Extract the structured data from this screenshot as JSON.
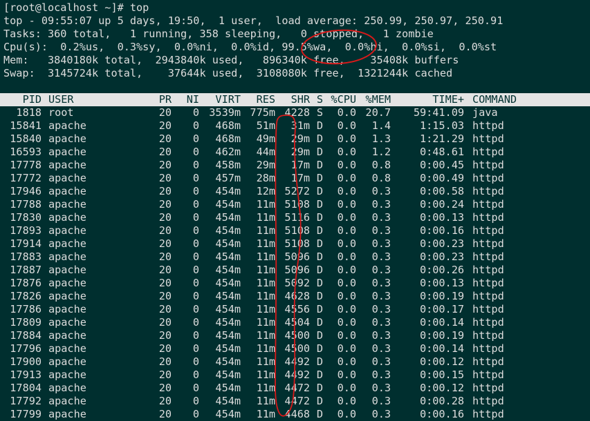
{
  "terminal": {
    "prompt_line": "[root@localhost ~]# top",
    "summary": [
      "top - 09:55:07 up 5 days, 19:50,  1 user,  load average: 250.99, 250.97, 250.91",
      "Tasks: 360 total,   1 running, 358 sleeping,   0 stopped,   1 zombie",
      "Cpu(s):  0.2%us,  0.3%sy,  0.0%ni,  0.0%id, 99.5%wa,  0.0%hi,  0.0%si,  0.0%st",
      "Mem:   3840180k total,  2943840k used,   896340k free,    35408k buffers",
      "Swap:  3145724k total,    37644k used,  3108080k free,  1321244k cached"
    ],
    "columns": [
      "PID",
      "USER",
      "PR",
      "NI",
      "VIRT",
      "RES",
      "SHR",
      "S",
      "%CPU",
      "%MEM",
      "TIME+",
      "COMMAND"
    ],
    "processes": [
      [
        "1818",
        "root",
        "20",
        "0",
        "3539m",
        "775m",
        "4228",
        "S",
        "0.0",
        "20.7",
        "59:41.09",
        "java"
      ],
      [
        "15841",
        "apache",
        "20",
        "0",
        "468m",
        "51m",
        "31m",
        "D",
        "0.0",
        "1.4",
        "1:15.03",
        "httpd"
      ],
      [
        "15840",
        "apache",
        "20",
        "0",
        "468m",
        "49m",
        "29m",
        "D",
        "0.0",
        "1.3",
        "1:21.29",
        "httpd"
      ],
      [
        "16593",
        "apache",
        "20",
        "0",
        "462m",
        "44m",
        "29m",
        "D",
        "0.0",
        "1.2",
        "0:48.61",
        "httpd"
      ],
      [
        "17778",
        "apache",
        "20",
        "0",
        "458m",
        "29m",
        "17m",
        "D",
        "0.0",
        "0.8",
        "0:00.45",
        "httpd"
      ],
      [
        "17772",
        "apache",
        "20",
        "0",
        "457m",
        "28m",
        "17m",
        "D",
        "0.0",
        "0.8",
        "0:00.49",
        "httpd"
      ],
      [
        "17946",
        "apache",
        "20",
        "0",
        "454m",
        "12m",
        "5272",
        "D",
        "0.0",
        "0.3",
        "0:00.58",
        "httpd"
      ],
      [
        "17788",
        "apache",
        "20",
        "0",
        "454m",
        "11m",
        "5108",
        "D",
        "0.0",
        "0.3",
        "0:00.24",
        "httpd"
      ],
      [
        "17830",
        "apache",
        "20",
        "0",
        "454m",
        "11m",
        "5116",
        "D",
        "0.0",
        "0.3",
        "0:00.13",
        "httpd"
      ],
      [
        "17893",
        "apache",
        "20",
        "0",
        "454m",
        "11m",
        "5108",
        "D",
        "0.0",
        "0.3",
        "0:00.16",
        "httpd"
      ],
      [
        "17914",
        "apache",
        "20",
        "0",
        "454m",
        "11m",
        "5108",
        "D",
        "0.0",
        "0.3",
        "0:00.23",
        "httpd"
      ],
      [
        "17883",
        "apache",
        "20",
        "0",
        "454m",
        "11m",
        "5096",
        "D",
        "0.0",
        "0.3",
        "0:00.23",
        "httpd"
      ],
      [
        "17887",
        "apache",
        "20",
        "0",
        "454m",
        "11m",
        "5096",
        "D",
        "0.0",
        "0.3",
        "0:00.26",
        "httpd"
      ],
      [
        "17876",
        "apache",
        "20",
        "0",
        "454m",
        "11m",
        "5092",
        "D",
        "0.0",
        "0.3",
        "0:00.13",
        "httpd"
      ],
      [
        "17826",
        "apache",
        "20",
        "0",
        "454m",
        "11m",
        "4628",
        "D",
        "0.0",
        "0.3",
        "0:00.19",
        "httpd"
      ],
      [
        "17786",
        "apache",
        "20",
        "0",
        "454m",
        "11m",
        "4556",
        "D",
        "0.0",
        "0.3",
        "0:00.17",
        "httpd"
      ],
      [
        "17809",
        "apache",
        "20",
        "0",
        "454m",
        "11m",
        "4504",
        "D",
        "0.0",
        "0.3",
        "0:00.14",
        "httpd"
      ],
      [
        "17884",
        "apache",
        "20",
        "0",
        "454m",
        "11m",
        "4500",
        "D",
        "0.0",
        "0.3",
        "0:00.19",
        "httpd"
      ],
      [
        "17796",
        "apache",
        "20",
        "0",
        "454m",
        "11m",
        "4500",
        "D",
        "0.0",
        "0.3",
        "0:00.14",
        "httpd"
      ],
      [
        "17900",
        "apache",
        "20",
        "0",
        "454m",
        "11m",
        "4492",
        "D",
        "0.0",
        "0.3",
        "0:00.12",
        "httpd"
      ],
      [
        "17913",
        "apache",
        "20",
        "0",
        "454m",
        "11m",
        "4492",
        "D",
        "0.0",
        "0.3",
        "0:00.15",
        "httpd"
      ],
      [
        "17804",
        "apache",
        "20",
        "0",
        "454m",
        "11m",
        "4472",
        "D",
        "0.0",
        "0.3",
        "0:00.12",
        "httpd"
      ],
      [
        "17792",
        "apache",
        "20",
        "0",
        "454m",
        "11m",
        "4472",
        "D",
        "0.0",
        "0.3",
        "0:00.28",
        "httpd"
      ],
      [
        "17799",
        "apache",
        "20",
        "0",
        "454m",
        "11m",
        "4468",
        "D",
        "0.0",
        "0.3",
        "0:00.16",
        "httpd"
      ]
    ]
  },
  "colors": {
    "background": "#002f2f",
    "foreground": "#dddddd",
    "header_bg": "#e4e4e4",
    "annotation": "#d81a1a"
  }
}
